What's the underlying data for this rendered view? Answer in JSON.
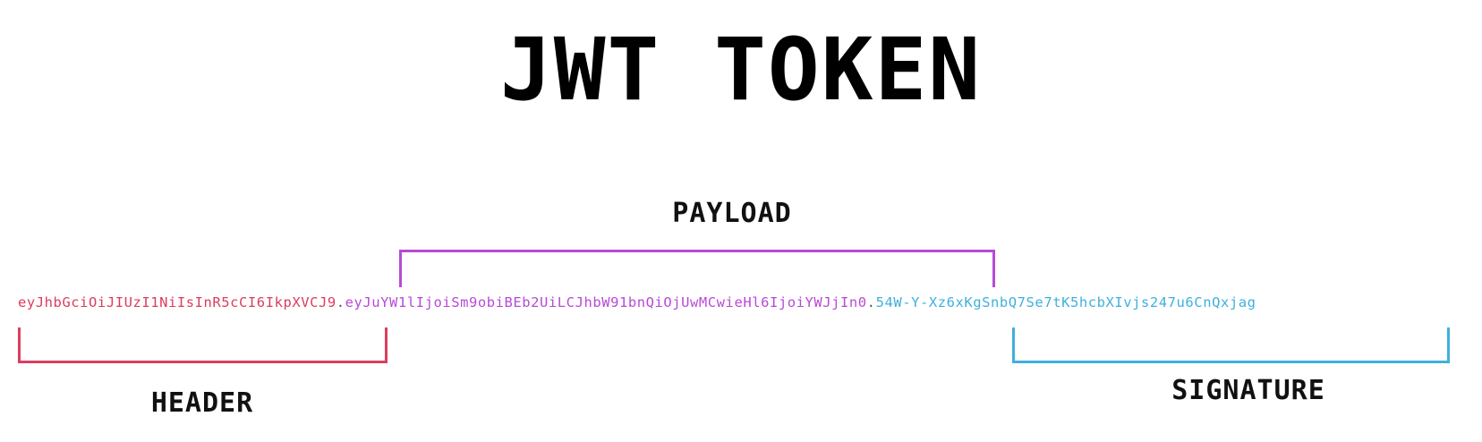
{
  "title": "JWT TOKEN",
  "labels": {
    "payload": "PAYLOAD",
    "header": "HEADER",
    "signature": "SIGNATURE"
  },
  "token": {
    "header": "eyJhbGciOiJIUzI1NiIsInR5cCI6IkpXVCJ9",
    "separator_1": ".",
    "payload": "eyJuYW1lIjoiSm9obiBEb2UiLCJhbW91bnQiOjUwMCwieHl6IjoiYWJjIn0",
    "separator_2": ".",
    "signature": "54W-Y-Xz6xKgSnbQ7Se7tK5hcbXIvjs247u6CnQxjag"
  },
  "colors": {
    "header": "#dc3d5e",
    "payload": "#b84ad6",
    "signature": "#3fb0de"
  }
}
